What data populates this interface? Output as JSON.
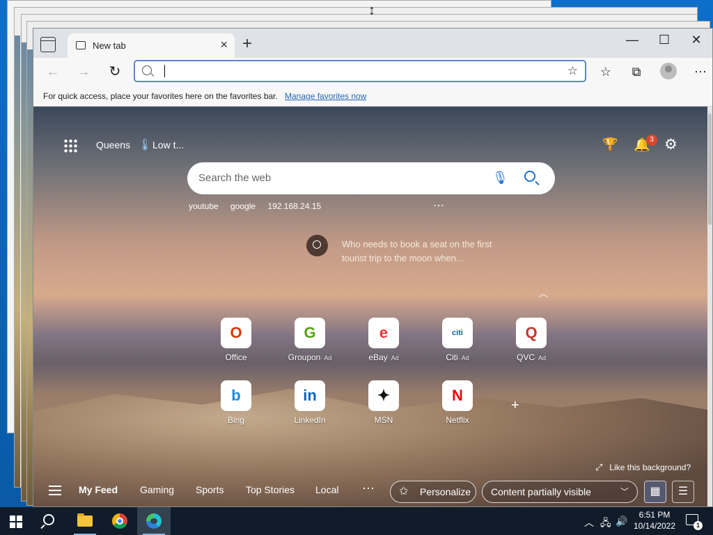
{
  "browser": {
    "tab_title": "New tab",
    "address_placeholder": "",
    "favorites_bar_message": "For quick access, place your favorites here on the favorites bar.",
    "manage_favorites_link": "Manage favorites now"
  },
  "ntp": {
    "weather_location": "Queens",
    "weather_text": "Low t...",
    "notification_count": "3",
    "search_placeholder": "Search the web",
    "search_history": [
      "youtube",
      "google",
      "192.168.24.15"
    ],
    "promo_text": "Who needs to book a seat on the first tourist trip to the moon when...",
    "tiles": [
      {
        "name": "Office",
        "ad": "",
        "glyph": "O",
        "color": "#d83b01"
      },
      {
        "name": "Groupon",
        "ad": "· Ad",
        "glyph": "G",
        "color": "#53a318"
      },
      {
        "name": "eBay",
        "ad": "· Ad",
        "glyph": "e",
        "color": "#e53238"
      },
      {
        "name": "Citi",
        "ad": "· Ad",
        "glyph": "citi",
        "color": "#0f5ca8"
      },
      {
        "name": "QVC",
        "ad": "· Ad",
        "glyph": "Q",
        "color": "#c0392b"
      },
      {
        "name": "Bing",
        "ad": "",
        "glyph": "b",
        "color": "#1e88e5"
      },
      {
        "name": "LinkedIn",
        "ad": "",
        "glyph": "in",
        "color": "#0a66c2"
      },
      {
        "name": "MSN",
        "ad": "",
        "glyph": "✦",
        "color": "#111111"
      },
      {
        "name": "Netflix",
        "ad": "",
        "glyph": "N",
        "color": "#e50914"
      }
    ],
    "like_background": "Like this background?",
    "feed_tabs": [
      "My Feed",
      "Gaming",
      "Sports",
      "Top Stories",
      "Local"
    ],
    "personalize_label": "Personalize",
    "content_visibility": "Content partially visible"
  },
  "taskbar": {
    "time": "6:51 PM",
    "date": "10/14/2022",
    "notification_count": "1"
  }
}
